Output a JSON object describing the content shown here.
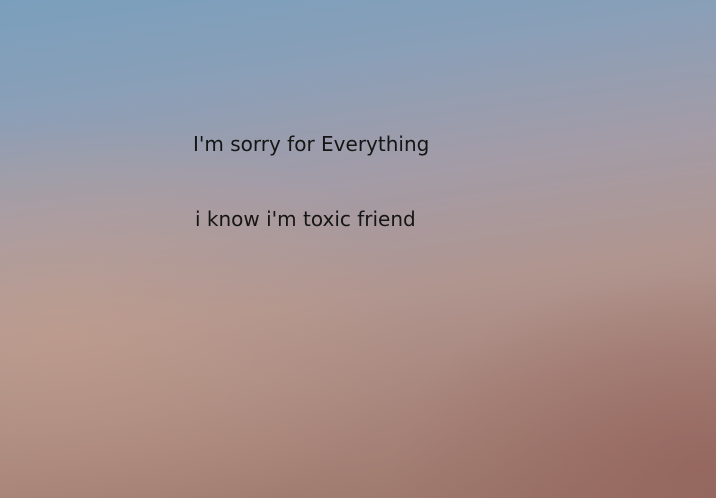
{
  "message": {
    "line_1": "I'm sorry for Everything",
    "line_2": "i know i'm toxic friend"
  },
  "background": {
    "top_color": "#7a9fbd",
    "middle_color": "#a39ca7",
    "bottom_color": "#9a7468"
  }
}
